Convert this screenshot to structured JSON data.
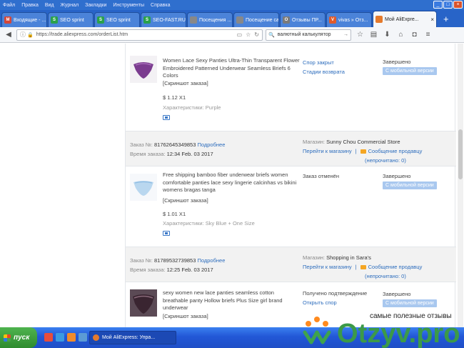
{
  "menubar": {
    "items": [
      "Файл",
      "Правка",
      "Вид",
      "Журнал",
      "Закладки",
      "Инструменты",
      "Справка"
    ]
  },
  "tabs": [
    {
      "label": "Входящие - ...",
      "color": "#d44638",
      "glyph": "M"
    },
    {
      "label": "SEO sprint",
      "color": "#2aa14a",
      "glyph": "S"
    },
    {
      "label": "SEO sprint",
      "color": "#2aa14a",
      "glyph": "S"
    },
    {
      "label": "SEO-FAST.RU",
      "color": "#2aa14a",
      "glyph": "S"
    },
    {
      "label": "Посещения ...",
      "color": "#888888",
      "glyph": ""
    },
    {
      "label": "Посещение сай...",
      "color": "#888888",
      "glyph": ""
    },
    {
      "label": "Отзывы ПР...",
      "color": "#7a7a7a",
      "glyph": "O"
    },
    {
      "label": "vivas » Отз...",
      "color": "#e05a2b",
      "glyph": "V"
    },
    {
      "label": "Мой AliExpre...",
      "color": "#e57a2c",
      "glyph": "",
      "active": true
    }
  ],
  "navbar": {
    "url": "https://trade.aliexpress.com/orderList.htm",
    "search_value": "валютный калькулятор"
  },
  "orders": [
    {
      "header": null,
      "item": {
        "title": "Women Lace Sexy Panties Ultra-Thin Transparent Flower Embroidered Patterned Underwear Seamless Briefs 6 Colors",
        "snapshot": "[Скриншот заказа]",
        "price": "$ 1.12 X1",
        "attrs_label": "Характеристики:",
        "attrs_value": "Purple",
        "status_links": [
          "Спор закрыт",
          "Стадии возврата"
        ],
        "state": "Завершено",
        "badge": "С мобильной версии"
      }
    },
    {
      "header": {
        "order_label": "Заказ №:",
        "order_number": "81762645349853",
        "details_link": "Подробнее",
        "time_label": "Время заказа:",
        "time_value": "12:34 Feb. 03 2017",
        "store_label": "Магазин:",
        "store_name": "Sunny Chou Commercial Store",
        "go_store": "Перейти к магазину",
        "message_link": "Сообщение продавцу",
        "unread": "(непрочитано: 0)"
      },
      "item": {
        "title": "Free shipping bamboo fiber underwear briefs women comfortable panties lace sexy lingerie calcinhas vs bikini womens bragas tanga",
        "snapshot": "[Скриншот заказа]",
        "price": "$ 1.01 X1",
        "attrs_label": "Характеристики:",
        "attrs_value": "Sky Blue + One Size",
        "status_text": "Заказ отменён",
        "state": "Завершено",
        "badge": "С мобильной версии"
      }
    },
    {
      "header": {
        "order_label": "Заказ №:",
        "order_number": "81789532739853",
        "details_link": "Подробнее",
        "time_label": "Время заказа:",
        "time_value": "12:25 Feb. 03 2017",
        "store_label": "Магазин:",
        "store_name": "Shopping in Sara's",
        "go_store": "Перейти к магазину",
        "message_link": "Сообщение продавцу",
        "unread": "(непрочитано: 0)"
      },
      "item": {
        "title": "sexy women new lace panties seamless cotton breathable panty Hollow briefs Plus Size girl brand underwear",
        "snapshot": "[Скриншот заказа]",
        "status_text": "Получено подтверждение",
        "status_link": "Открыть спор",
        "state": "Завершено",
        "badge": "С мобильной версии"
      }
    }
  ],
  "taskbar": {
    "start_label": "пуск",
    "task_label": "Мой AliExpress: Упра..."
  },
  "watermark": {
    "tagline": "самые полезные отзывы",
    "brand": "Otzyv.pro"
  }
}
